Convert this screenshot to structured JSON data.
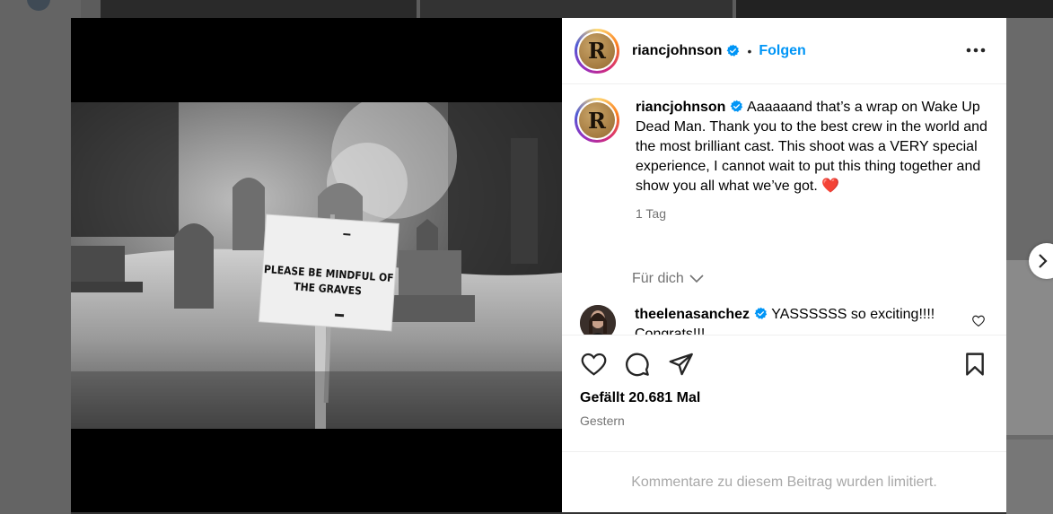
{
  "post": {
    "username": "riancjohnson",
    "follow_label": "Folgen",
    "separator": "•",
    "avatar_letter": "R",
    "caption": "Aaaaaand that’s a wrap on Wake Up Dead Man. Thank you to the best crew in the world and the most brilliant cast. This shoot was a VERY special experience, I cannot wait to put this thing together and show you all what we’ve got.",
    "caption_emoji": "❤️",
    "caption_time": "1 Tag",
    "sign_text": "PLEASE BE MINDFUL OF THE GRAVES"
  },
  "for_you": {
    "label": "Für dich"
  },
  "comments": [
    {
      "username": "theelenasanchez",
      "text": "YASSSSSS so exciting!!!! Congrats!!!"
    }
  ],
  "likes": {
    "label": "Gefällt 20.681 Mal"
  },
  "date": {
    "label": "Gestern"
  },
  "limited": {
    "label": "Kommentare zu diesem Beitrag wurden limitiert."
  },
  "icons": {
    "more": "more-horizontal-icon",
    "like": "heart-icon",
    "comment": "comment-bubble-icon",
    "share": "paper-plane-icon",
    "save": "bookmark-icon",
    "verified": "verified-badge-icon",
    "next": "chevron-right-icon",
    "expand": "chevron-down-icon"
  },
  "colors": {
    "follow": "#0095f6",
    "verified": "#0095f6",
    "heart": "#ed4956",
    "muted": "#737373"
  }
}
